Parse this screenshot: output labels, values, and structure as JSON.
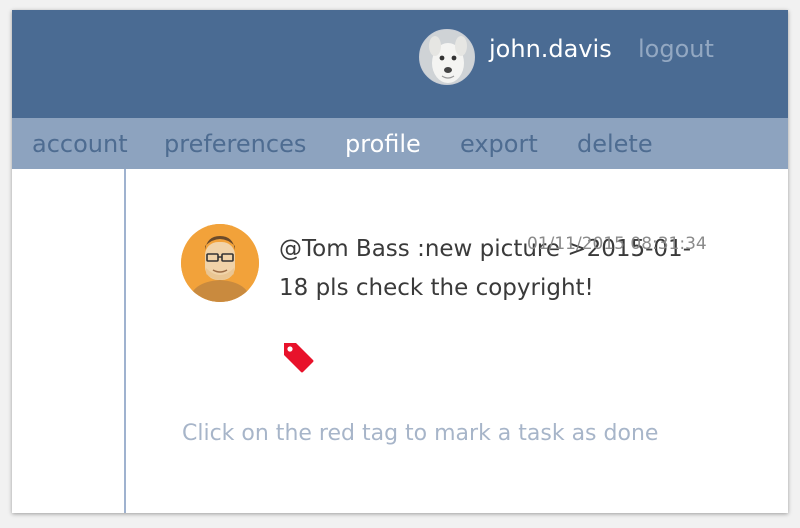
{
  "header": {
    "username": "john.davis",
    "logout_label": "logout",
    "avatar_icon": "dog-avatar-icon"
  },
  "nav": {
    "items": [
      {
        "label": "account",
        "active": false
      },
      {
        "label": "preferences",
        "active": false
      },
      {
        "label": "profile",
        "active": true
      },
      {
        "label": "export",
        "active": false
      },
      {
        "label": "delete",
        "active": false
      }
    ]
  },
  "message": {
    "text": "@Tom Bass :new picture >2015-01-18 pls check the copyright!",
    "timestamp": "01/11/2015 08:31:34",
    "avatar_icon": "user-avatar-icon",
    "tag_icon": "red-tag-icon"
  },
  "hint": "Click on the red tag to mark a task as done",
  "colors": {
    "header_bg": "#4a6b93",
    "nav_bg": "#8da3bf",
    "nav_active": "#ffffff",
    "nav_inactive": "#4e6c91",
    "tag": "#e8122b",
    "hint": "#a7b5c9"
  }
}
